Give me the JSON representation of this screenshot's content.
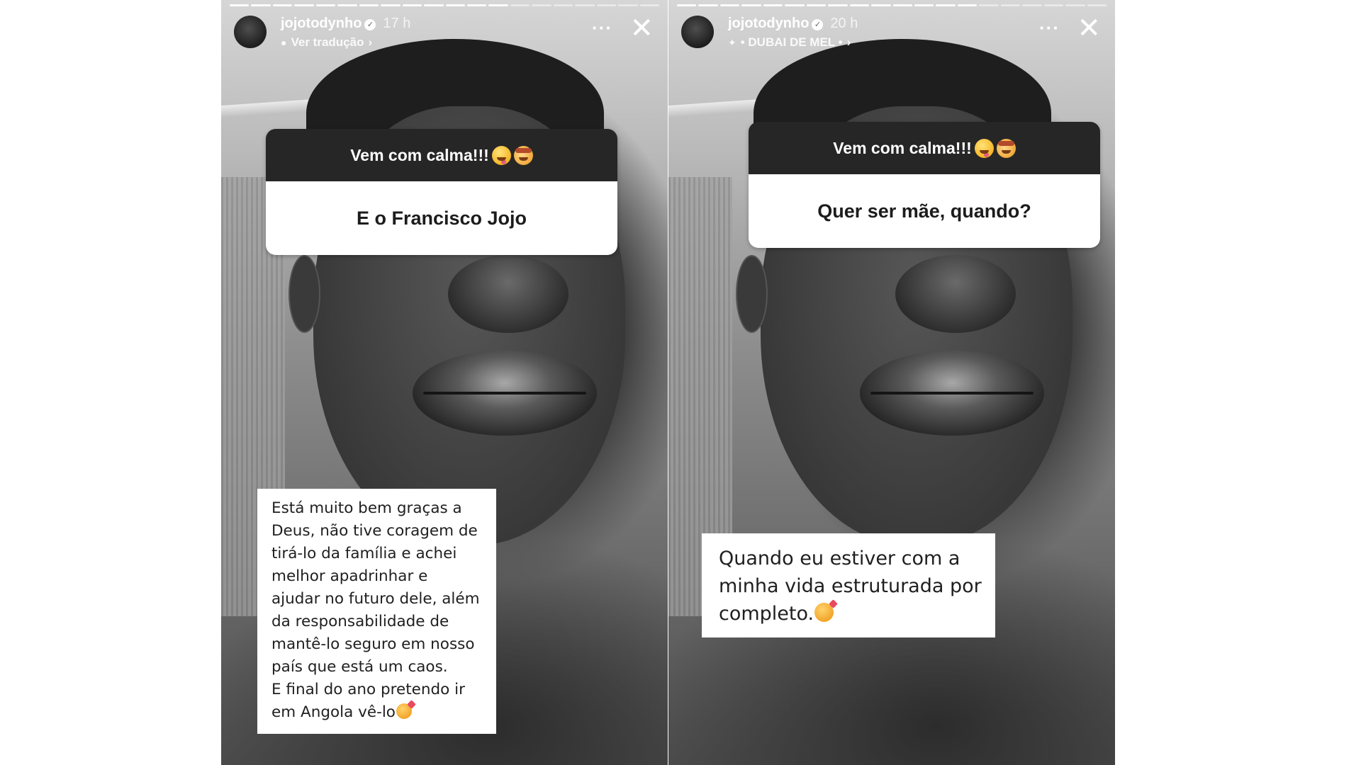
{
  "stories": [
    {
      "username": "jojotodynho",
      "time_ago": "17 h",
      "subline": {
        "icon": "chat-bubble-icon",
        "text": "Ver tradução",
        "chevron": "›"
      },
      "more_label": "···",
      "close_label": "✕",
      "progress": {
        "segments": 20,
        "completed": 13
      },
      "question": {
        "header": "Vem com calma!!!",
        "header_emojis": [
          "zany-face-emoji",
          "exploding-head-emoji"
        ],
        "text": "E o Francisco Jojo"
      },
      "answer": {
        "lines": [
          "Está muito bem graças a",
          "Deus, não tive coragem de",
          "tirá-lo da família e achei",
          "melhor apadrinhar e",
          "ajudar no futuro dele, além",
          "da responsabilidade de",
          "mantê-lo seguro em nosso",
          "país que está um caos.",
          "E final do ano pretendo ir",
          "em Angola vê-lo"
        ],
        "end_emoji": "smiling-face-with-hearts-emoji"
      }
    },
    {
      "username": "jojotodynho",
      "time_ago": "20 h",
      "subline": {
        "icon": "sparkles-icon",
        "text": "• DUBAI DE MEL •",
        "chevron": "›"
      },
      "more_label": "···",
      "close_label": "✕",
      "progress": {
        "segments": 20,
        "completed": 14
      },
      "question": {
        "header": "Vem com calma!!!",
        "header_emojis": [
          "zany-face-emoji",
          "exploding-head-emoji"
        ],
        "text": "Quer ser mãe, quando?"
      },
      "answer": {
        "lines": [
          "Quando eu estiver com a",
          "minha vida estruturada por",
          "completo."
        ],
        "end_emoji": "smiling-face-with-hearts-emoji"
      }
    }
  ]
}
